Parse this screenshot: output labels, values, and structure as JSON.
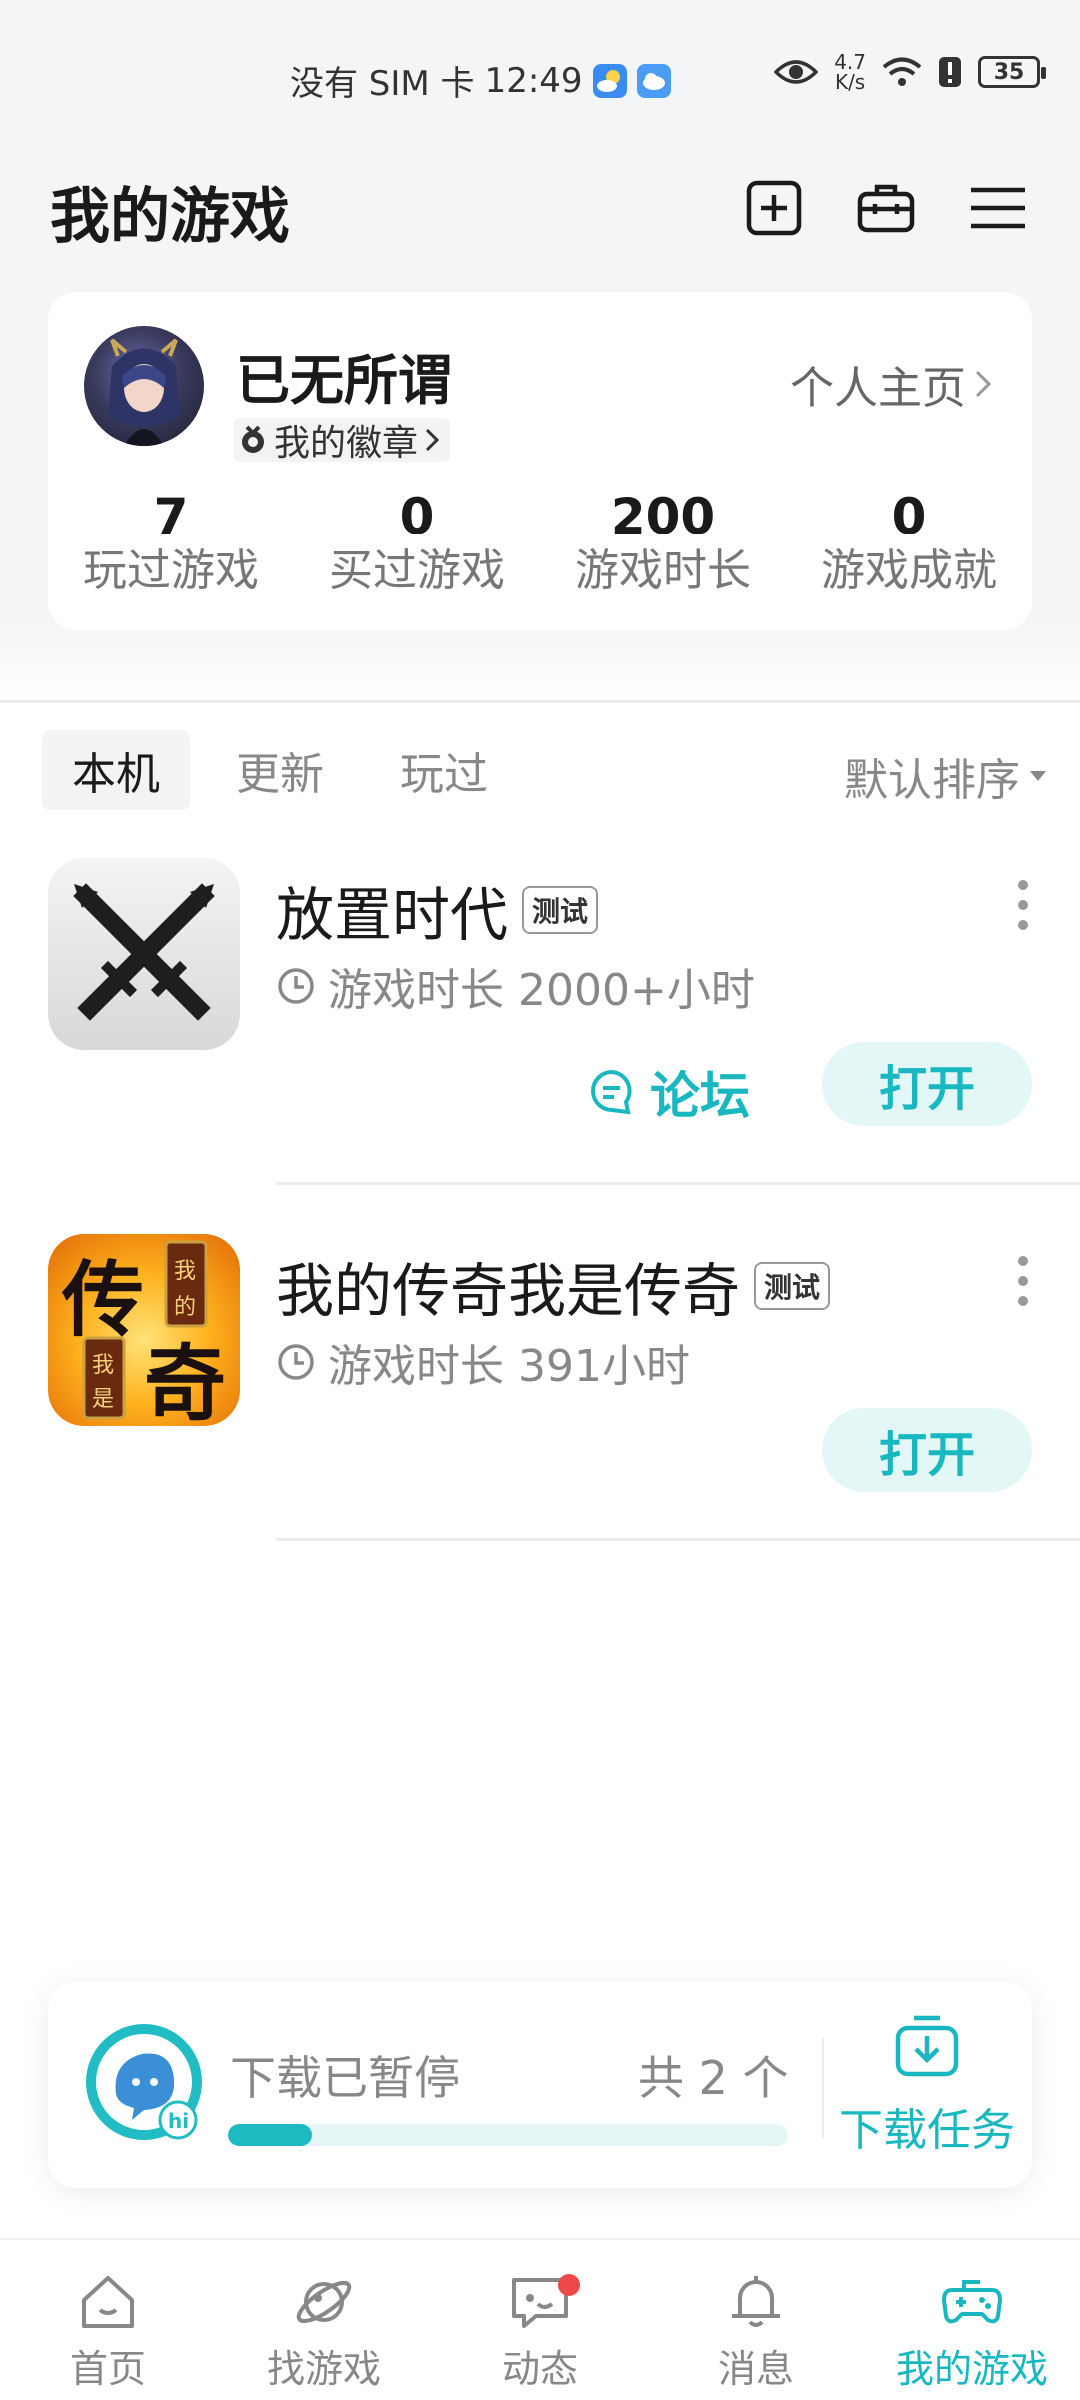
{
  "status_bar": {
    "carrier": "没有 SIM 卡",
    "time": "12:49",
    "net_speed_value": "4.7",
    "net_speed_unit": "K/s",
    "battery": "35"
  },
  "header": {
    "title": "我的游戏",
    "icons": [
      "add-square-icon",
      "toolbox-icon",
      "menu-icon"
    ]
  },
  "profile": {
    "username": "已无所谓",
    "badge_label": "我的徽章",
    "homepage_label": "个人主页",
    "stats": [
      {
        "value": "7",
        "label": "玩过游戏"
      },
      {
        "value": "0",
        "label": "买过游戏"
      },
      {
        "value": "200",
        "label": "游戏时长"
      },
      {
        "value": "0",
        "label": "游戏成就"
      }
    ]
  },
  "tabs": [
    {
      "label": "本机",
      "active": true
    },
    {
      "label": "更新",
      "active": false
    },
    {
      "label": "玩过",
      "active": false
    }
  ],
  "sort_label": "默认排序",
  "games": [
    {
      "name": "放置时代",
      "tag": "测试",
      "play_time": "游戏时长 2000+小时",
      "forum_label": "论坛",
      "open_label": "打开"
    },
    {
      "name": "我的传奇我是传奇",
      "tag": "测试",
      "play_time": "游戏时长 391小时",
      "open_label": "打开"
    }
  ],
  "download": {
    "status": "下载已暂停",
    "count": "共 2 个",
    "progress": 0.15,
    "task_label": "下载任务"
  },
  "bottom_nav": [
    {
      "label": "首页",
      "icon": "home-icon",
      "active": false
    },
    {
      "label": "找游戏",
      "icon": "planet-icon",
      "active": false
    },
    {
      "label": "动态",
      "icon": "chat-icon",
      "active": false,
      "dot": true
    },
    {
      "label": "消息",
      "icon": "bell-icon",
      "active": false
    },
    {
      "label": "我的游戏",
      "icon": "gamepad-icon",
      "active": true
    }
  ],
  "colors": {
    "accent": "#19b7bf",
    "accent_light": "#e3f7f7",
    "notification_dot": "#f04848"
  }
}
